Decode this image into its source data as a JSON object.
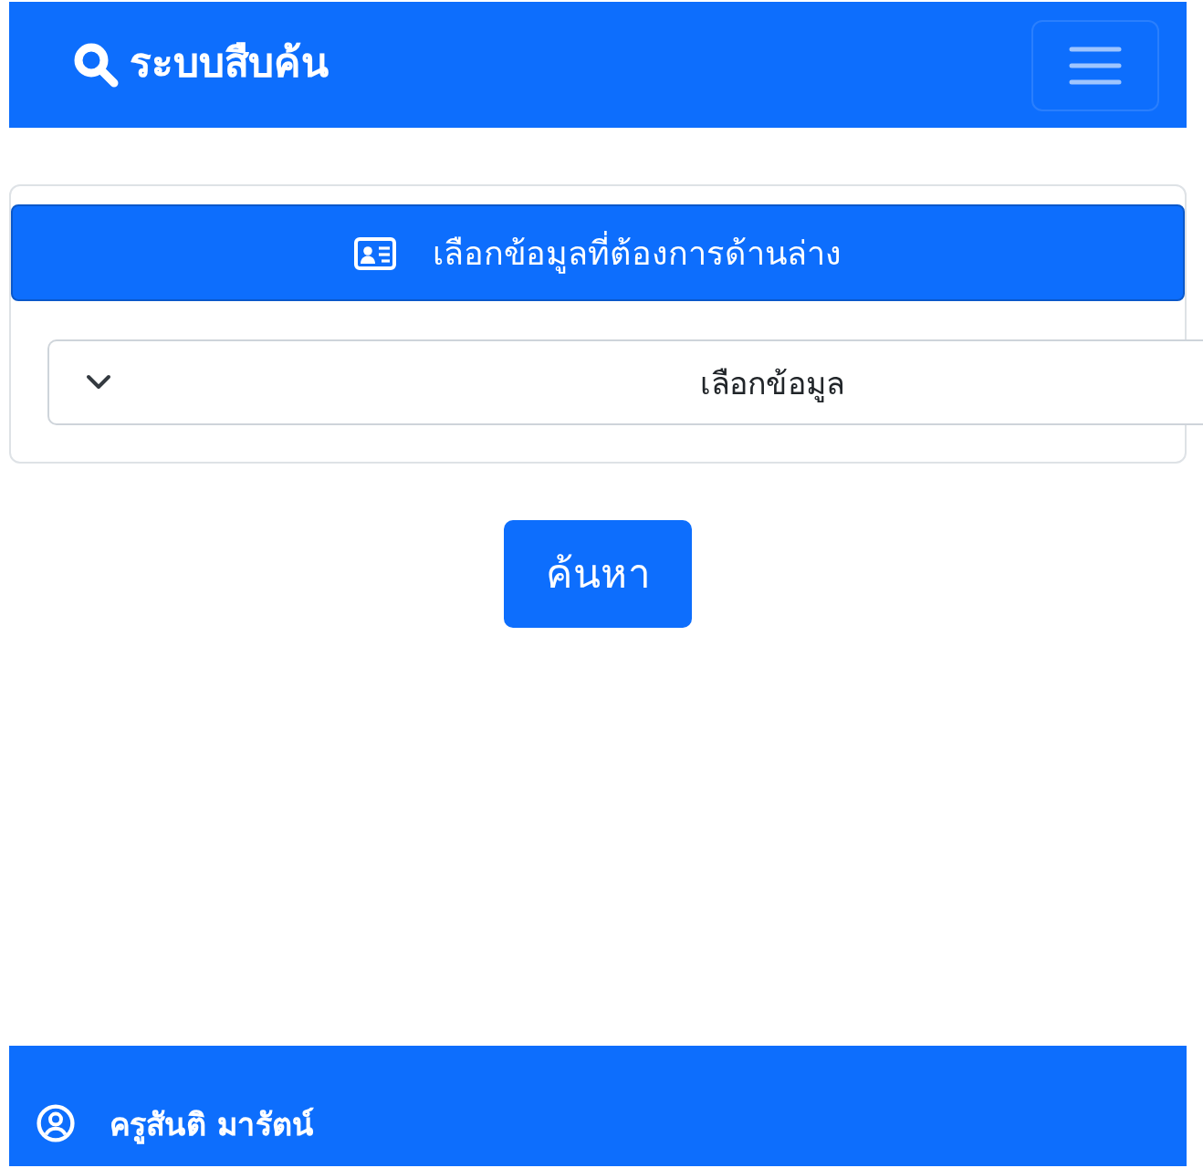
{
  "navbar": {
    "title": "ระบบสืบค้น"
  },
  "card": {
    "header": "เลือกข้อมูลที่ต้องการด้านล่าง",
    "select": {
      "value": "เลือกข้อมูล"
    }
  },
  "search_button": {
    "label": "ค้นหา"
  },
  "footer": {
    "user": "ครูสันติ มารัตน์"
  }
}
